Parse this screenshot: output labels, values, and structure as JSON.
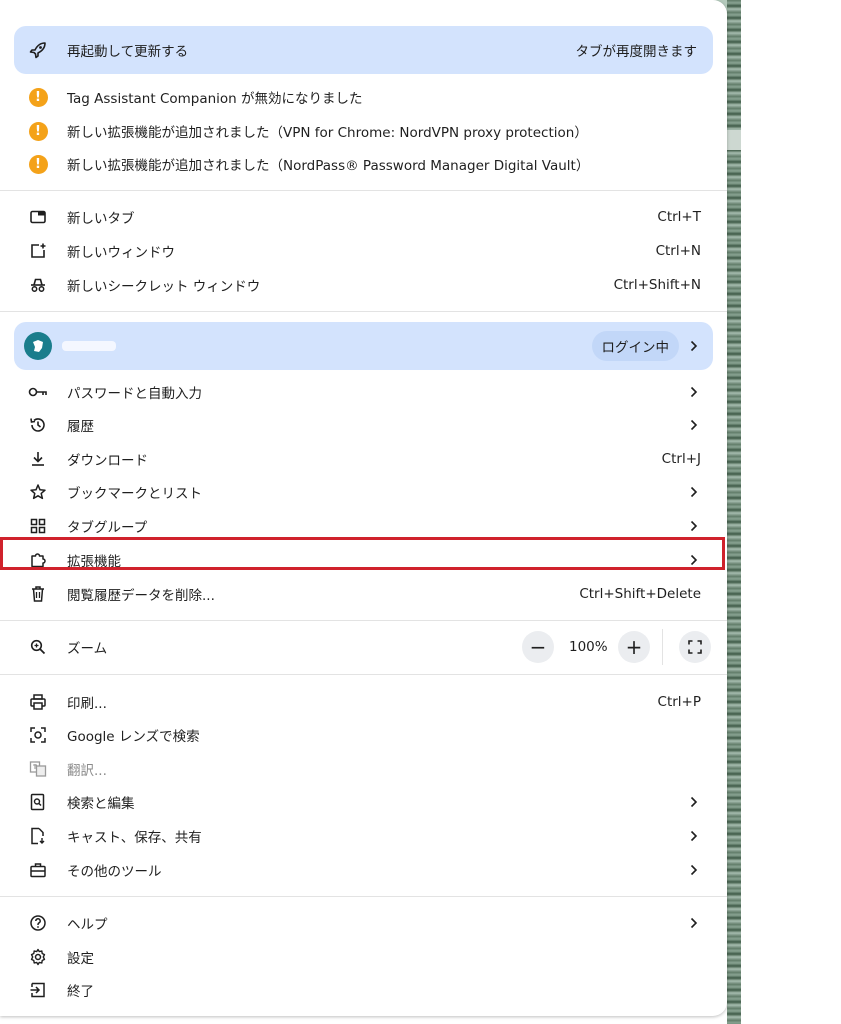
{
  "update": {
    "label": "再起動して更新する",
    "note": "タブが再度開きます"
  },
  "alerts": [
    {
      "label": "Tag Assistant Companion が無効になりました"
    },
    {
      "label": "新しい拡張機能が追加されました（VPN for Chrome: NordVPN proxy protection）"
    },
    {
      "label": "新しい拡張機能が追加されました（NordPass® Password Manager  Digital Vault）"
    }
  ],
  "new_items": [
    {
      "label": "新しいタブ",
      "shortcut": "Ctrl+T"
    },
    {
      "label": "新しいウィンドウ",
      "shortcut": "Ctrl+N"
    },
    {
      "label": "新しいシークレット ウィンドウ",
      "shortcut": "Ctrl+Shift+N"
    }
  ],
  "profile": {
    "badge": "ログイン中"
  },
  "main_items": [
    {
      "label": "パスワードと自動入力"
    },
    {
      "label": "履歴"
    },
    {
      "label": "ダウンロード",
      "shortcut": "Ctrl+J"
    },
    {
      "label": "ブックマークとリスト"
    },
    {
      "label": "タブグループ"
    },
    {
      "label": "拡張機能"
    },
    {
      "label": "閲覧履歴データを削除...",
      "shortcut": "Ctrl+Shift+Delete"
    }
  ],
  "zoom": {
    "label": "ズーム",
    "value": "100%",
    "minus": "−",
    "plus": "+"
  },
  "tool_items": [
    {
      "label": "印刷...",
      "shortcut": "Ctrl+P"
    },
    {
      "label": "Google レンズで検索"
    },
    {
      "label": "翻訳..."
    },
    {
      "label": "検索と編集"
    },
    {
      "label": "キャスト、保存、共有"
    },
    {
      "label": "その他のツール"
    }
  ],
  "bottom_items": [
    {
      "label": "ヘルプ"
    },
    {
      "label": "設定"
    },
    {
      "label": "終了"
    }
  ],
  "colors": {
    "accent_pill": "#d3e3fd",
    "warning": "#f4a219",
    "highlight": "#d0222c"
  },
  "icons": [
    "rocket-icon",
    "warning-icon",
    "new-tab-icon",
    "new-window-icon",
    "incognito-icon",
    "avatar",
    "key-icon",
    "history-icon",
    "download-icon",
    "star-icon",
    "tab-groups-icon",
    "puzzle-icon",
    "trash-icon",
    "zoom-icon",
    "fullscreen-icon",
    "print-icon",
    "lens-icon",
    "translate-icon",
    "find-icon",
    "cast-save-icon",
    "toolbox-icon",
    "help-icon",
    "gear-icon",
    "exit-icon",
    "chevron-right-icon"
  ]
}
